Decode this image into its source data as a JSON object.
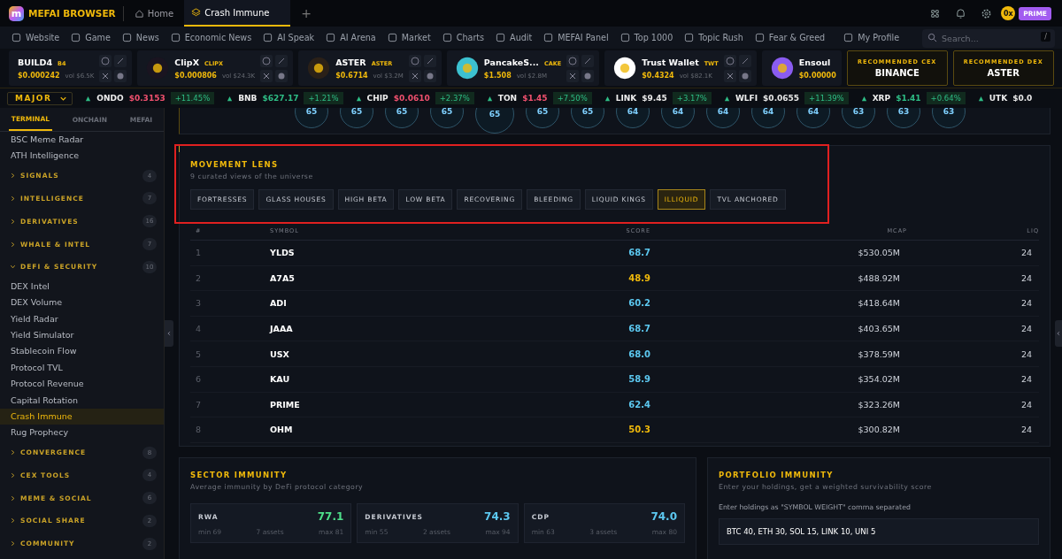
{
  "app": {
    "name": "MEFAI BROWSER",
    "logo_letter": "m"
  },
  "tabs": [
    {
      "label": "Home",
      "selected": false
    },
    {
      "label": "Crash Immune",
      "selected": true
    }
  ],
  "new_tab": "+",
  "account": {
    "badge": "0x",
    "plan": "PRIME"
  },
  "nav": [
    "Website",
    "Game",
    "News",
    "Economic News",
    "AI Speak",
    "AI Arena",
    "Market",
    "Charts",
    "Audit",
    "MEFAI Panel",
    "Top 1000",
    "Topic Rush",
    "Fear & Greed",
    "My Profile"
  ],
  "search": {
    "placeholder": "Search...",
    "shortcut": "/"
  },
  "tokens": [
    {
      "name": "BUILD4",
      "symbol": "B4",
      "price": "$0.000242",
      "vol": "vol $6.5K"
    },
    {
      "name": "ClipX",
      "symbol": "CLIPX",
      "price": "$0.000806",
      "vol": "vol $24.3K",
      "color": "#1a1420"
    },
    {
      "name": "ASTER",
      "symbol": "ASTER",
      "price": "$0.6714",
      "vol": "vol $3.2M",
      "color": "#2a2018"
    },
    {
      "name": "PancakeS...",
      "symbol": "CAKE",
      "price": "$1.508",
      "vol": "vol $2.8M",
      "color": "#3cc1d0"
    },
    {
      "name": "Trust Wallet",
      "symbol": "TWT",
      "price": "$0.4324",
      "vol": "vol $82.1K",
      "color": "#ffffff"
    },
    {
      "name": "Ensoul",
      "price": "$0.00000",
      "color": "#8a5cf0"
    }
  ],
  "recommended": [
    {
      "title": "RECOMMENDED CEX",
      "name": "BINANCE"
    },
    {
      "title": "RECOMMENDED DEX",
      "name": "ASTER"
    }
  ],
  "ticker": {
    "filter": "MAJOR",
    "items": [
      {
        "symbol": "ONDO",
        "price": "$0.3153",
        "color": "#f0506e",
        "change": "+11.45%"
      },
      {
        "symbol": "BNB",
        "price": "$627.17",
        "color": "#2ebd85",
        "change": "+1.21%"
      },
      {
        "symbol": "CHIP",
        "price": "$0.0610",
        "color": "#f0506e",
        "change": "+2.37%"
      },
      {
        "symbol": "TON",
        "price": "$1.45",
        "color": "#f0506e",
        "change": "+7.50%"
      },
      {
        "symbol": "LINK",
        "price": "$9.45",
        "color": "#e8e8e8",
        "change": "+3.17%"
      },
      {
        "symbol": "WLFI",
        "price": "$0.0655",
        "color": "#e8e8e8",
        "change": "+11.39%"
      },
      {
        "symbol": "XRP",
        "price": "$1.41",
        "color": "#2ebd85",
        "change": "+0.64%"
      },
      {
        "symbol": "UTK",
        "price": "$0.0",
        "color": "#e8e8e8"
      }
    ]
  },
  "sidebar": {
    "tabs": [
      {
        "label": "TERMINAL",
        "selected": true
      },
      {
        "label": "ONCHAIN",
        "selected": false
      },
      {
        "label": "MEFAI",
        "selected": false
      }
    ],
    "items": [
      {
        "label": "BSC Meme Radar",
        "selected": false
      },
      {
        "label": "ATH Intelligence",
        "selected": false
      },
      {
        "label": "SIGNALS",
        "count": "4",
        "expanded": false
      },
      {
        "label": "INTELLIGENCE",
        "count": "7",
        "expanded": false
      },
      {
        "label": "DERIVATIVES",
        "count": "16",
        "expanded": false
      },
      {
        "label": "WHALE & INTEL",
        "count": "7",
        "expanded": false
      },
      {
        "label": "DEFI & SECURITY",
        "count": "10",
        "expanded": true,
        "children": [
          {
            "label": "DEX Intel",
            "selected": false
          },
          {
            "label": "DEX Volume",
            "selected": false
          },
          {
            "label": "Yield Radar",
            "selected": false
          },
          {
            "label": "Yield Simulator",
            "selected": false
          },
          {
            "label": "Stablecoin Flow",
            "selected": false
          },
          {
            "label": "Protocol TVL",
            "selected": false
          },
          {
            "label": "Protocol Revenue",
            "selected": false
          },
          {
            "label": "Capital Rotation",
            "selected": false
          },
          {
            "label": "Crash Immune",
            "selected": true
          },
          {
            "label": "Rug Prophecy",
            "selected": false
          }
        ]
      },
      {
        "label": "CONVERGENCE",
        "count": "8",
        "expanded": false
      },
      {
        "label": "CEX TOOLS",
        "count": "4",
        "expanded": false
      },
      {
        "label": "MEME & SOCIAL",
        "count": "6",
        "expanded": false
      },
      {
        "label": "SOCIAL SHARE",
        "count": "2",
        "expanded": false
      },
      {
        "label": "COMMUNITY",
        "count": "2",
        "expanded": false
      }
    ]
  },
  "scores": [
    "65",
    "65",
    "65",
    "65",
    "65",
    "65",
    "65",
    "64",
    "64",
    "64",
    "64",
    "64",
    "63",
    "63",
    "63"
  ],
  "lens": {
    "title": "MOVEMENT LENS",
    "subtitle": "9 curated views of the universe",
    "filters": [
      {
        "label": "FORTRESSES",
        "selected": false
      },
      {
        "label": "GLASS HOUSES",
        "selected": false
      },
      {
        "label": "HIGH BETA",
        "selected": false
      },
      {
        "label": "LOW BETA",
        "selected": false
      },
      {
        "label": "RECOVERING",
        "selected": false
      },
      {
        "label": "BLEEDING",
        "selected": false
      },
      {
        "label": "LIQUID KINGS",
        "selected": false
      },
      {
        "label": "ILLIQUID",
        "selected": true
      },
      {
        "label": "TVL ANCHORED",
        "selected": false
      }
    ],
    "columns": [
      "#",
      "SYMBOL",
      "SCORE",
      "MCAP",
      "LIQ"
    ],
    "rows": [
      {
        "rank": "1",
        "symbol": "YLDS",
        "score": "68.7",
        "color": "#5cc8f0",
        "mcap": "$530.05M",
        "liq": "24"
      },
      {
        "rank": "2",
        "symbol": "A7A5",
        "score": "48.9",
        "color": "#f0b90b",
        "mcap": "$488.92M",
        "liq": "24"
      },
      {
        "rank": "3",
        "symbol": "ADI",
        "score": "60.2",
        "color": "#5cc8f0",
        "mcap": "$418.64M",
        "liq": "24"
      },
      {
        "rank": "4",
        "symbol": "JAAA",
        "score": "68.7",
        "color": "#5cc8f0",
        "mcap": "$403.65M",
        "liq": "24"
      },
      {
        "rank": "5",
        "symbol": "USX",
        "score": "68.0",
        "color": "#5cc8f0",
        "mcap": "$378.59M",
        "liq": "24"
      },
      {
        "rank": "6",
        "symbol": "KAU",
        "score": "58.9",
        "color": "#5cc8f0",
        "mcap": "$354.02M",
        "liq": "24"
      },
      {
        "rank": "7",
        "symbol": "PRIME",
        "score": "62.4",
        "color": "#5cc8f0",
        "mcap": "$323.26M",
        "liq": "24"
      },
      {
        "rank": "8",
        "symbol": "OHM",
        "score": "50.3",
        "color": "#f0b90b",
        "mcap": "$300.82M",
        "liq": "24"
      }
    ]
  },
  "sector": {
    "title": "SECTOR IMMUNITY",
    "subtitle": "Average immunity by DeFi protocol category",
    "cards": [
      {
        "name": "RWA",
        "score": "77.1",
        "color": "#4ee08a",
        "min": "min 69",
        "assets": "7 assets",
        "max": "max 81"
      },
      {
        "name": "DERIVATIVES",
        "score": "74.3",
        "color": "#5cc8f0",
        "min": "min 55",
        "assets": "2 assets",
        "max": "max 94"
      },
      {
        "name": "CDP",
        "score": "74.0",
        "color": "#5cc8f0",
        "min": "min 63",
        "assets": "3 assets",
        "max": "max 80"
      }
    ]
  },
  "portfolio": {
    "title": "PORTFOLIO IMMUNITY",
    "subtitle": "Enter your holdings, get a weighted survivability score",
    "label": "Enter holdings as \"SYMBOL WEIGHT\" comma separated",
    "value": "BTC 40, ETH 30, SOL 15, LINK 10, UNI 5"
  }
}
